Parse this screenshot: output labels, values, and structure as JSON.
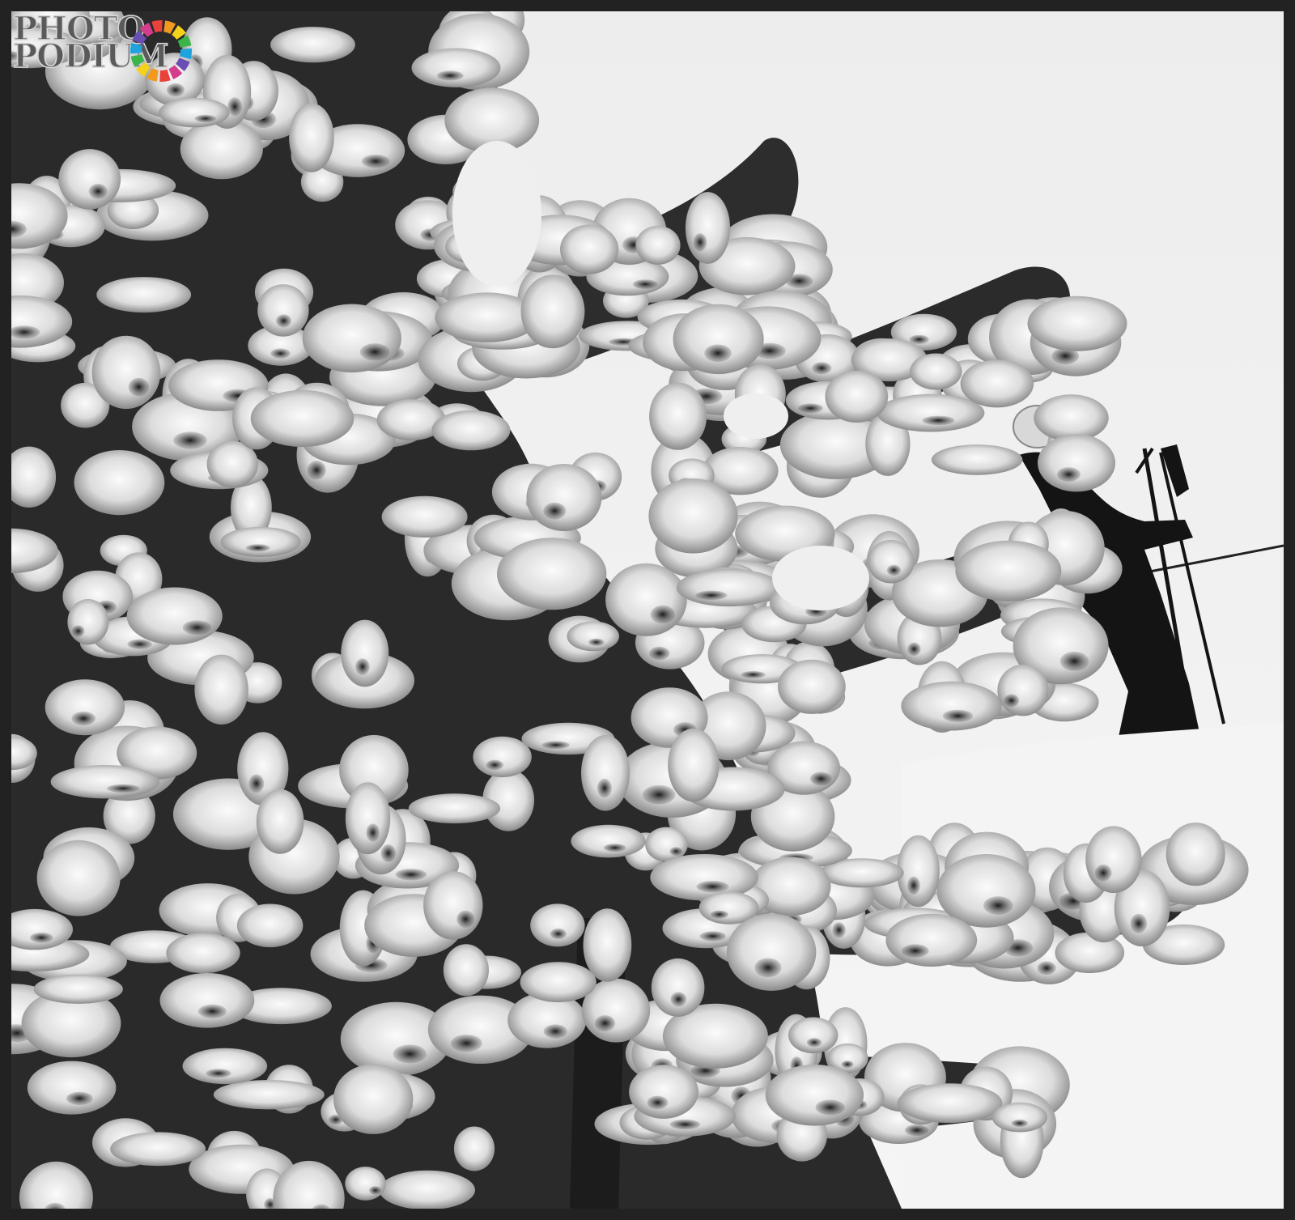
{
  "image": {
    "description": "",
    "tone": "black-and-white",
    "colors": {
      "sky": "#e9e9e9",
      "frame": "#222222",
      "snow": "#f7f7f7",
      "needles": "#1a1a1a",
      "silhouette": "#141414"
    }
  },
  "watermark": {
    "line1": "PHOTO",
    "line2": "PODIUM",
    "logo_colors": [
      "#e8423a",
      "#f29a1f",
      "#f4d21c",
      "#3bb54a",
      "#1fa3dc",
      "#6a4fb3",
      "#d43d8c"
    ]
  }
}
